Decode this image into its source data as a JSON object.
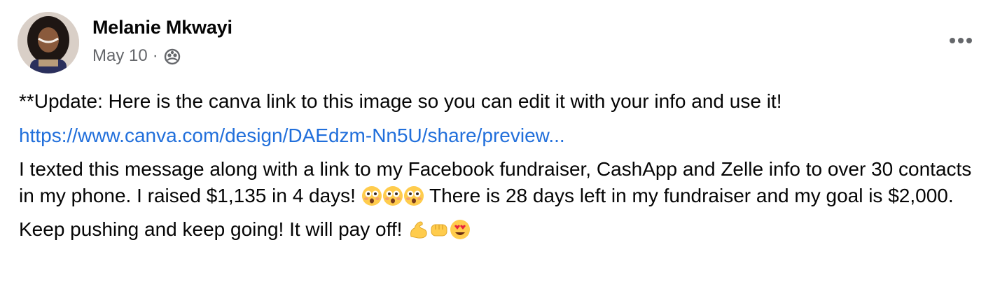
{
  "post": {
    "author": "Melanie Mkwayi",
    "date": "May 10",
    "separator": "·",
    "audience_icon": "friends-icon",
    "more_icon": "more-options-icon"
  },
  "content": {
    "update_line": "**Update: Here is the canva link to this image so you can edit it with your info and use it!",
    "link_text": "https://www.canva.com/design/DAEdzm-Nn5U/share/preview...",
    "paragraph_main_before_emoji": "I texted this message along with a link to my Facebook fundraiser, CashApp and Zelle info to over 30 contacts in my phone. I raised $1,135 in 4 days!",
    "paragraph_main_after_emoji": "There is 28 days left in my fundraiser and my goal is $2,000.",
    "emojis_main": [
      "flushed-face-emoji",
      "flushed-face-emoji",
      "flushed-face-emoji"
    ],
    "closing_line": "Keep pushing and keep going! It will pay off!",
    "emojis_closing": [
      "flexed-biceps-emoji",
      "oncoming-fist-emoji",
      "heart-eyes-emoji"
    ]
  },
  "colors": {
    "text": "#050505",
    "secondary": "#65676b",
    "link": "#216fdb"
  }
}
